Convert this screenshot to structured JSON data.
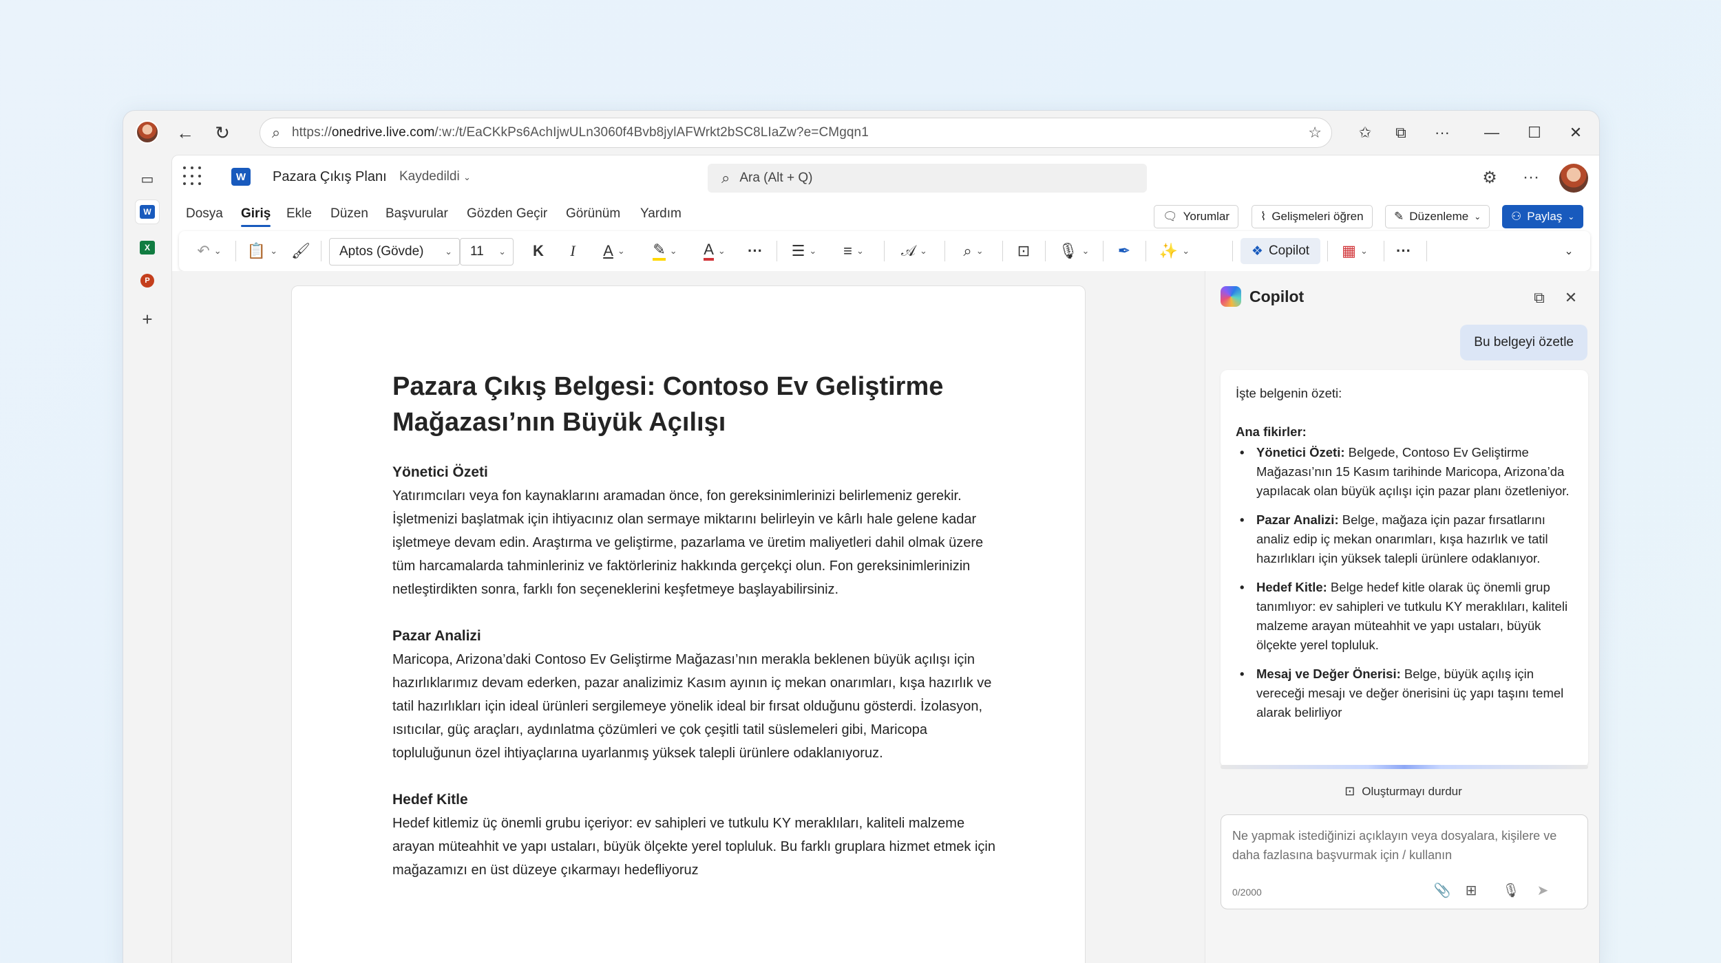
{
  "browser": {
    "url_prefix": "https://",
    "url_domain": "onedrive.live.com",
    "url_path": "/:w:/t/EaCKkPs6AchIjwULn3060f4Bvb8jylAFWrkt2bSC8LIaZw?e=CMgqn1"
  },
  "app": {
    "doc_name": "Pazara Çıkış Planı",
    "saved_status": "Kaydedildi",
    "search_placeholder": "Ara (Alt + Q)"
  },
  "ribbon": {
    "tabs": [
      "Dosya",
      "Giriş",
      "Ekle",
      "Düzen",
      "Başvurular",
      "Gözden Geçir",
      "Görünüm",
      "Yardım"
    ],
    "comments": "Yorumlar",
    "catch_up": "Gelişmeleri öğren",
    "editing": "Düzenleme",
    "share": "Paylaş"
  },
  "toolbar": {
    "font": "Aptos (Gövde)",
    "size": "11",
    "bold": "K",
    "italic": "I",
    "copilot": "Copilot"
  },
  "document": {
    "title": "Pazara Çıkış Belgesi: Contoso Ev Geliştirme Mağazası’nın Büyük Açılışı",
    "sections": [
      {
        "heading": "Yönetici Özeti",
        "body": "Yatırımcıları veya fon kaynaklarını aramadan önce, fon gereksinimlerinizi belirlemeniz gerekir. İşletmenizi başlatmak için ihtiyacınız olan sermaye miktarını belirleyin ve kârlı hale gelene kadar işletmeye devam edin. Araştırma ve geliştirme, pazarlama ve üretim maliyetleri dahil olmak üzere tüm harcamalarda tahminleriniz ve faktörleriniz hakkında gerçekçi olun. Fon gereksinimlerinizin netleştirdikten sonra, farklı fon seçeneklerini keşfetmeye başlayabilirsiniz."
      },
      {
        "heading": "Pazar Analizi",
        "body": "Maricopa, Arizona’daki Contoso Ev Geliştirme Mağazası’nın merakla beklenen büyük açılışı için hazırlıklarımız devam ederken, pazar analizimiz Kasım ayının iç mekan onarımları, kışa hazırlık ve tatil hazırlıkları için ideal ürünleri sergilemeye yönelik ideal bir fırsat olduğunu gösterdi. İzolasyon, ısıtıcılar, güç araçları, aydınlatma çözümleri ve çok çeşitli tatil süslemeleri gibi, Maricopa topluluğunun özel ihtiyaçlarına uyarlanmış yüksek talepli ürünlere odaklanıyoruz."
      },
      {
        "heading": "Hedef Kitle",
        "body": "Hedef kitlemiz üç önemli grubu içeriyor: ev sahipleri ve tutkulu KY meraklıları, kaliteli malzeme arayan müteahhit ve yapı ustaları, büyük ölçekte yerel topluluk. Bu farklı gruplara hizmet etmek için mağazamızı en üst düzeye çıkarmayı hedefliyoruz"
      }
    ]
  },
  "copilot": {
    "title": "Copilot",
    "user_prompt": "Bu belgeyi özetle",
    "intro": "İşte belgenin özeti:",
    "key_points_heading": "Ana fikirler:",
    "points": [
      {
        "label": "Yönetici Özeti:",
        "text": " Belgede, Contoso Ev Geliştirme Mağazası’nın 15 Kasım tarihinde Maricopa, Arizona’da yapılacak olan büyük açılışı için pazar planı özetleniyor."
      },
      {
        "label": "Pazar Analizi:",
        "text": " Belge, mağaza için pazar fırsatlarını analiz edip iç mekan onarımları, kışa hazırlık ve tatil hazırlıkları için yüksek talepli ürünlere odaklanıyor."
      },
      {
        "label": "Hedef Kitle:",
        "text": " Belge hedef kitle olarak üç önemli grup tanımlıyor: ev sahipleri ve tutkulu KY meraklıları, kaliteli malzeme arayan müteahhit ve yapı ustaları, büyük ölçekte yerel topluluk."
      },
      {
        "label": "Mesaj ve Değer Önerisi:",
        "text": " Belge, büyük açılış için vereceği mesajı ve değer önerisini üç yapı taşını temel alarak belirliyor"
      }
    ],
    "stop_label": "Oluşturmayı durdur",
    "input_placeholder": "Ne yapmak istediğinizi açıklayın veya dosyalara, kişilere ve daha fazlasına başvurmak için / kullanın",
    "char_counter": "0/2000"
  }
}
